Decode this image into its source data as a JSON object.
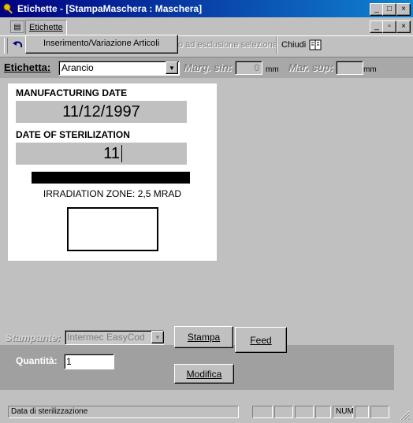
{
  "window": {
    "title": "Etichette - [StampaMaschera : Maschera]",
    "controls": [
      "_",
      "□",
      "×"
    ],
    "mdi_controls": [
      "_",
      "▫",
      "×"
    ]
  },
  "menu": {
    "items": [
      {
        "label": "Etichette"
      }
    ],
    "dropdown": [
      {
        "label": "Inserimento/Variazione Articoli"
      }
    ]
  },
  "toolbar": {
    "exclude_selection_label": "o ad esclusione selezione",
    "close_label": "Chiudi"
  },
  "form": {
    "etichetta_label": "Etichetta:",
    "etichetta_value": "Arancio",
    "marg_sin_label": "Marg. sin:",
    "marg_sin_value": "0",
    "marg_sin_unit": "mm",
    "mar_sup_label": "Mar. sup:",
    "mar_sup_value": "",
    "mar_sup_unit": "mm"
  },
  "label_preview": {
    "manufacturing_label": "MANUFACTURING DATE",
    "manufacturing_value": "11/12/1997",
    "sterilization_label": "DATE OF STERILIZATION",
    "sterilization_value": "11",
    "irradiation_text": "IRRADIATION ZONE: 2,5 MRAD"
  },
  "print_panel": {
    "printer_label": "Stampante:",
    "printer_value": "Intermec EasyCod",
    "quantity_label": "Quantità:",
    "quantity_value": "1",
    "print_button": "Stampa",
    "feed_button": "Feed",
    "modify_button": "Modifica"
  },
  "status": {
    "message": "Data di sterilizzazione",
    "num_indicator": "NUM"
  }
}
